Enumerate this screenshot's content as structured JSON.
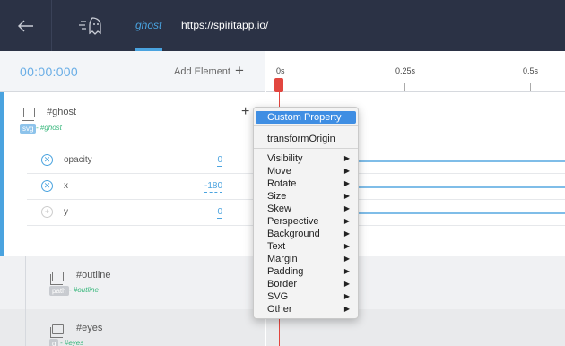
{
  "header": {
    "tab_label": "ghost",
    "url": "https://spiritapp.io/"
  },
  "panel": {
    "timecode": "00:00:000",
    "add_element_label": "Add Element",
    "elements": [
      {
        "name": "#ghost",
        "tag": "svg",
        "sub": "- #ghost",
        "tag_color": "#8dc3eb"
      },
      {
        "name": "#outline",
        "tag": "path",
        "sub": "- #outline",
        "tag_color": "#c8cbd0"
      },
      {
        "name": "#eyes",
        "tag": "g",
        "sub": "- #eyes",
        "tag_color": "#c8cbd0"
      }
    ],
    "properties": [
      {
        "name": "opacity",
        "value": "0",
        "active": true
      },
      {
        "name": "x",
        "value": "-180",
        "active": true
      },
      {
        "name": "y",
        "value": "0",
        "active": false
      }
    ]
  },
  "timeline": {
    "ticks": [
      "0s",
      "0.25s",
      "0.5s"
    ]
  },
  "menu": {
    "items": [
      {
        "label": "Custom Property",
        "submenu": false,
        "active": true
      },
      {
        "label": "transformOrigin",
        "submenu": false,
        "active": false
      },
      {
        "label": "Visibility",
        "submenu": true
      },
      {
        "label": "Move",
        "submenu": true
      },
      {
        "label": "Rotate",
        "submenu": true
      },
      {
        "label": "Size",
        "submenu": true
      },
      {
        "label": "Skew",
        "submenu": true
      },
      {
        "label": "Perspective",
        "submenu": true
      },
      {
        "label": "Background",
        "submenu": true
      },
      {
        "label": "Text",
        "submenu": true
      },
      {
        "label": "Margin",
        "submenu": true
      },
      {
        "label": "Padding",
        "submenu": true
      },
      {
        "label": "Border",
        "submenu": true
      },
      {
        "label": "SVG",
        "submenu": true
      },
      {
        "label": "Other",
        "submenu": true
      }
    ]
  },
  "colors": {
    "header_bg": "#2b3245",
    "accent": "#4aa3df",
    "playhead": "#e2463f",
    "menu_highlight": "#3f8ee3"
  }
}
